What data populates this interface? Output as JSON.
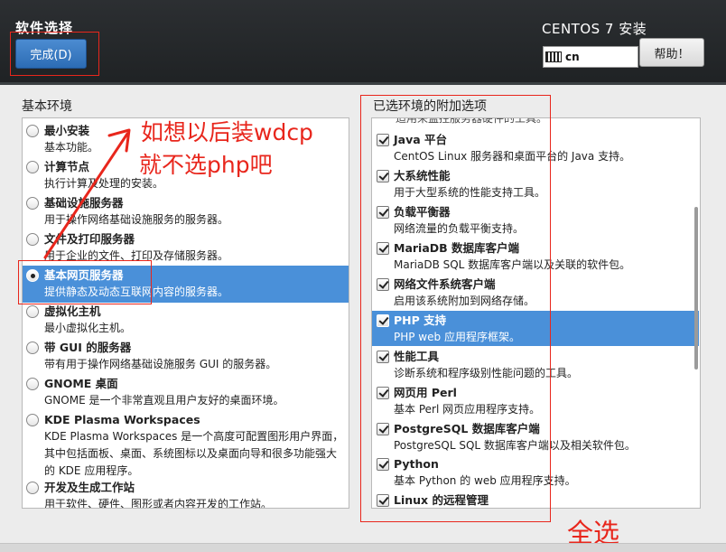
{
  "header": {
    "title": "软件选择",
    "done_label": "完成(D)",
    "product": "CENTOS 7 安装",
    "keyboard_layout": "cn",
    "help_label": "帮助！"
  },
  "base_environment": {
    "label": "基本环境",
    "items": [
      {
        "title": "最小安装",
        "desc": "基本功能。",
        "selected": false
      },
      {
        "title": "计算节点",
        "desc": "执行计算及处理的安装。",
        "selected": false
      },
      {
        "title": "基础设施服务器",
        "desc": "用于操作网络基础设施服务的服务器。",
        "selected": false
      },
      {
        "title": "文件及打印服务器",
        "desc": "用于企业的文件、打印及存储服务器。",
        "selected": false
      },
      {
        "title": "基本网页服务器",
        "desc": "提供静态及动态互联网内容的服务器。",
        "selected": true
      },
      {
        "title": "虚拟化主机",
        "desc": "最小虚拟化主机。",
        "selected": false
      },
      {
        "title": "带 GUI 的服务器",
        "desc": "带有用于操作网络基础设施服务 GUI 的服务器。",
        "selected": false
      },
      {
        "title": "GNOME 桌面",
        "desc": "GNOME 是一个非常直观且用户友好的桌面环境。",
        "selected": false
      },
      {
        "title": "KDE Plasma Workspaces",
        "desc": "KDE Plasma Workspaces 是一个高度可配置图形用户界面，其中包括面板、桌面、系统图标以及桌面向导和很多功能强大的 KDE 应用程序。",
        "selected": false
      },
      {
        "title": "开发及生成工作站",
        "desc": "用于软件、硬件、图形或者内容开发的工作站。",
        "selected": false
      }
    ]
  },
  "addons": {
    "label": "已选环境的附加选项",
    "clipped_top_text": "适用来监控服务器硬件的工具。",
    "items": [
      {
        "title": "Java 平台",
        "desc": "CentOS Linux 服务器和桌面平台的 Java 支持。",
        "checked": true,
        "selected": false
      },
      {
        "title": "大系统性能",
        "desc": "用于大型系统的性能支持工具。",
        "checked": true,
        "selected": false
      },
      {
        "title": "负载平衡器",
        "desc": "网络流量的负载平衡支持。",
        "checked": true,
        "selected": false
      },
      {
        "title": "MariaDB 数据库客户端",
        "desc": "MariaDB SQL 数据库客户端以及关联的软件包。",
        "checked": true,
        "selected": false
      },
      {
        "title": "网络文件系统客户端",
        "desc": "启用该系统附加到网络存储。",
        "checked": true,
        "selected": false
      },
      {
        "title": "PHP 支持",
        "desc": "PHP web 应用程序框架。",
        "checked": true,
        "selected": true
      },
      {
        "title": "性能工具",
        "desc": "诊断系统和程序级别性能问题的工具。",
        "checked": true,
        "selected": false
      },
      {
        "title": "网页用 Perl",
        "desc": "基本 Perl 网页应用程序支持。",
        "checked": true,
        "selected": false
      },
      {
        "title": "PostgreSQL 数据库客户端",
        "desc": "PostgreSQL SQL 数据库客户端以及相关软件包。",
        "checked": true,
        "selected": false
      },
      {
        "title": "Python",
        "desc": "基本 Python 的 web 应用程序支持。",
        "checked": true,
        "selected": false
      },
      {
        "title": "Linux 的远程管理",
        "desc": "",
        "checked": true,
        "selected": false
      }
    ]
  },
  "annotations": {
    "note_line1": "如想以后装wdcp",
    "note_line2": "就不选php吧",
    "select_all": "全选"
  },
  "colors": {
    "selection": "#4a90d9",
    "annotation_red": "#e8261c",
    "header_bg": "#2c2f32"
  }
}
